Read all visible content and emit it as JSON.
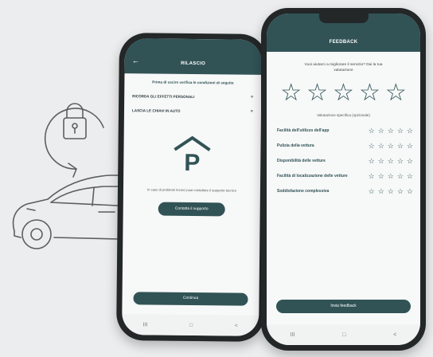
{
  "left_screen": {
    "title": "RILASCIO",
    "back_icon": "arrow-left-icon",
    "intro": "Prima di uscire verifica le condizioni di seguito",
    "checks": [
      {
        "label": "RICORDA GLI EFFETTI PERSONALI",
        "icon": "double-chevron-right-icon"
      },
      {
        "label": "LASCIA LE CHIAVI IN AUTO",
        "icon": "double-chevron-right-icon"
      }
    ],
    "parking_letter": "P",
    "help_text": "In caso di problemi tecnici puoi contattare il supporto tecnico",
    "contact_button": "Contatta il supporto",
    "continue_button": "Continua",
    "nav": {
      "recent": "III",
      "home": "□",
      "back": "<"
    }
  },
  "right_screen": {
    "title": "FEEDBACK",
    "question": "Vuoi aiutarci a migliorare il servizio? Dai la tua valutazione",
    "overall_rating_stars": 5,
    "specific_label": "Valutazione specifica (opzionale)",
    "criteria": [
      {
        "label": "Facilità dell'utilizzo dell'app"
      },
      {
        "label": "Pulizia della vettura"
      },
      {
        "label": "Disponibilità delle vetture"
      },
      {
        "label": "Facilità di localizzazione delle vetture"
      },
      {
        "label": "Soddisfazione complessiva"
      }
    ],
    "send_button": "Invia feedback",
    "nav": {
      "recent": "III",
      "home": "□",
      "back": "<"
    }
  },
  "colors": {
    "accent": "#315356",
    "background": "#ecedee",
    "line": "#5a5f60"
  },
  "icons": [
    "lock-icon",
    "car-outline-icon",
    "star-outline-icon",
    "parking-icon"
  ]
}
